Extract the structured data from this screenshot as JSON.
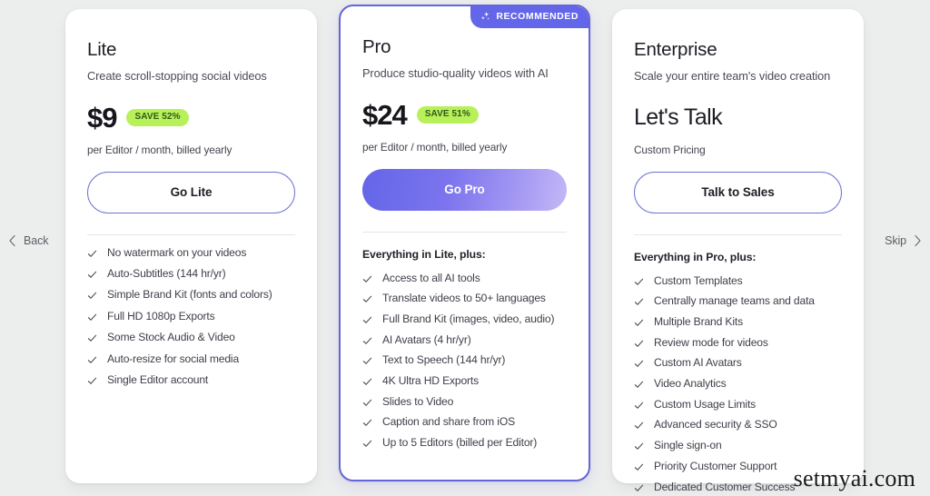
{
  "nav": {
    "back_label": "Back",
    "skip_label": "Skip",
    "back_icon": "chevron-left-icon",
    "skip_icon": "chevron-right-icon"
  },
  "watermark": "setmyai.com",
  "colors": {
    "background": "#eceded",
    "card_background": "#ffffff",
    "accent_purple": "#6366e8",
    "highlight_border": "#6366d8",
    "save_badge_background": "#b8f05a",
    "save_badge_text": "#30591a",
    "recommended_badge_background": "#6366e8"
  },
  "plans": [
    {
      "id": "lite",
      "name": "Lite",
      "tagline": "Create scroll-stopping social videos",
      "price": "$9",
      "save_badge": "SAVE 52%",
      "billing_note": "per Editor / month, billed yearly",
      "cta_label": "Go Lite",
      "cta_style": "outline",
      "features_heading": "",
      "features": [
        "No watermark on your videos",
        "Auto-Subtitles (144 hr/yr)",
        "Simple Brand Kit (fonts and colors)",
        "Full HD 1080p Exports",
        "Some Stock Audio & Video",
        "Auto-resize for social media",
        "Single Editor account"
      ]
    },
    {
      "id": "pro",
      "name": "Pro",
      "tagline": "Produce studio-quality videos with AI",
      "price": "$24",
      "save_badge": "SAVE 51%",
      "billing_note": "per Editor / month, billed yearly",
      "cta_label": "Go Pro",
      "cta_style": "filled",
      "badge_label": "RECOMMENDED",
      "badge_icon": "sparkles-icon",
      "features_heading": "Everything in Lite, plus:",
      "features": [
        "Access to all AI tools",
        "Translate videos to 50+ languages",
        "Full Brand Kit (images, video, audio)",
        "AI Avatars (4 hr/yr)",
        "Text to Speech (144 hr/yr)",
        "4K Ultra HD Exports",
        "Slides to Video",
        "Caption and share from iOS",
        "Up to 5 Editors (billed per Editor)"
      ]
    },
    {
      "id": "enterprise",
      "name": "Enterprise",
      "tagline": "Scale your entire team's video creation",
      "price": "Let's Talk",
      "save_badge": "",
      "billing_note": "Custom Pricing",
      "cta_label": "Talk to Sales",
      "cta_style": "outline",
      "features_heading": "Everything in Pro, plus:",
      "features": [
        "Custom Templates",
        "Centrally manage teams and data",
        "Multiple Brand Kits",
        "Review mode for videos",
        "Custom AI Avatars",
        "Video Analytics",
        "Custom Usage Limits",
        "Advanced security & SSO",
        "Single sign-on",
        "Priority Customer Support",
        "Dedicated Customer Success"
      ]
    }
  ]
}
